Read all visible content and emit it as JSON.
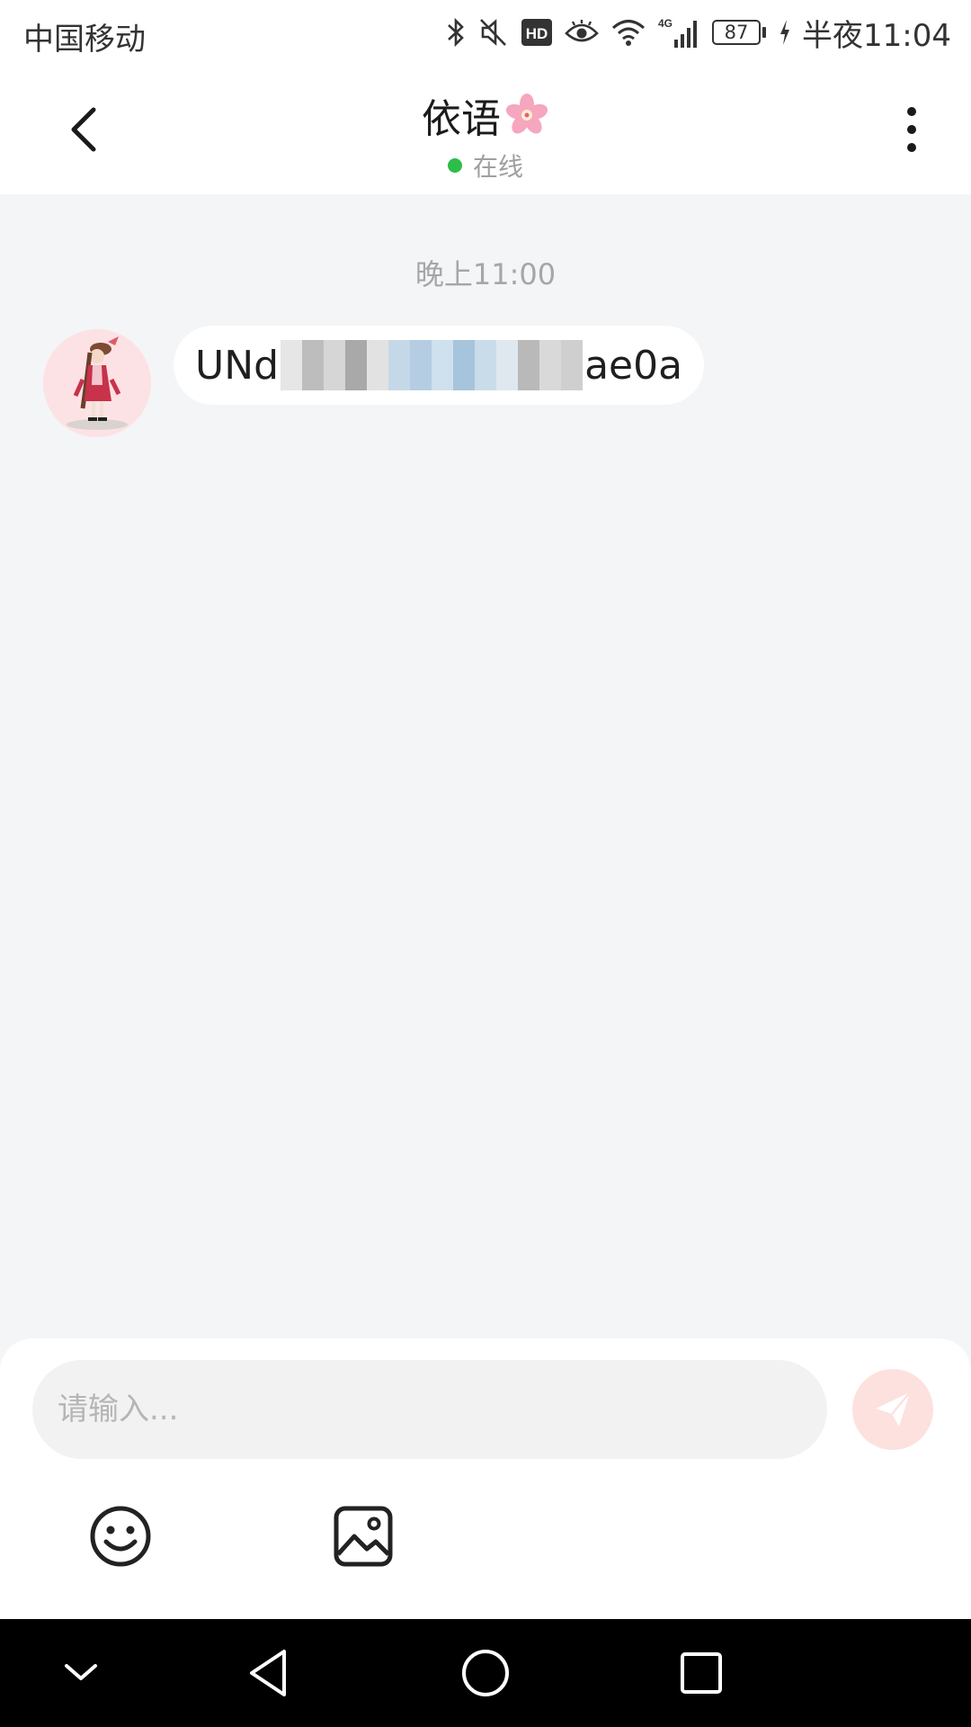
{
  "status_bar": {
    "carrier": "中国移动",
    "battery": "87",
    "time": "半夜11:04",
    "icons": [
      "bluetooth-icon",
      "mute-icon",
      "hd-icon",
      "eye-icon",
      "wifi-icon",
      "signal-4g-icon",
      "battery-icon",
      "charging-icon"
    ]
  },
  "header": {
    "title": "依语",
    "title_emoji": "🌸",
    "status": "在线",
    "status_color": "#2ebd4b"
  },
  "chat": {
    "messages": [
      {
        "time": "晚上11:00",
        "sender": "contact",
        "text_start": "UNd",
        "text_end": "ae0a"
      }
    ]
  },
  "composer": {
    "placeholder": "请输入...",
    "send_color": "#fde1df"
  },
  "nav": {
    "icons": [
      "collapse-icon",
      "back-triangle-icon",
      "home-circle-icon",
      "recents-square-icon"
    ]
  }
}
